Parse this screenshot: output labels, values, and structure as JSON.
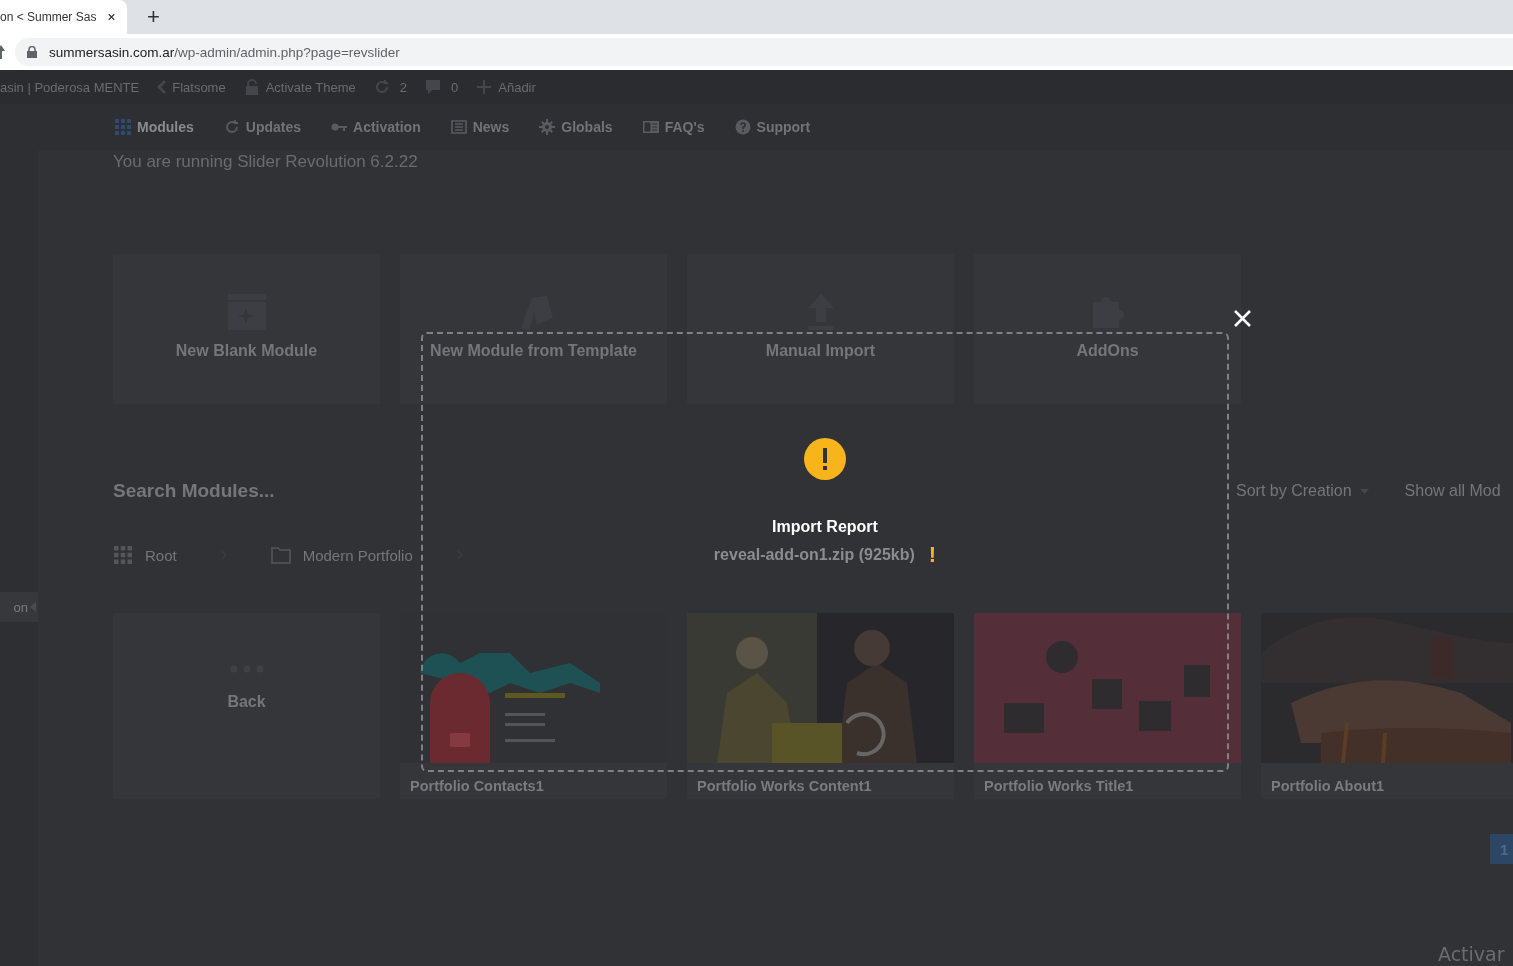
{
  "browser": {
    "tab": {
      "title": "on < Summer Sas",
      "selected": true
    },
    "new_tab": "+",
    "url_host": "summersasin.com.ar",
    "url_path": "/wp-admin/admin.php?page=revslider"
  },
  "admin_bar": [
    {
      "kind": "text",
      "label": "asin | Poderosa MENTE"
    },
    {
      "kind": "theme",
      "label": "Flatsome"
    },
    {
      "kind": "lock",
      "label": "Activate Theme"
    },
    {
      "kind": "updates",
      "label": "2"
    },
    {
      "kind": "comments",
      "label": "0"
    },
    {
      "kind": "add",
      "label": "Añadir"
    }
  ],
  "nav": [
    {
      "label": "Modules",
      "selected": true
    },
    {
      "label": "Updates",
      "selected": false
    },
    {
      "label": "Activation",
      "selected": false
    },
    {
      "label": "News",
      "selected": false
    },
    {
      "label": "Globals",
      "selected": false
    },
    {
      "label": "FAQ's",
      "selected": false
    },
    {
      "label": "Support",
      "selected": false
    }
  ],
  "version_notice": "You are running Slider Revolution 6.2.22",
  "actions": [
    {
      "label": "New Blank Module"
    },
    {
      "label": "New Module from Template"
    },
    {
      "label": "Manual Import"
    },
    {
      "label": "AddOns"
    }
  ],
  "search": {
    "placeholder": "Search Modules..."
  },
  "sort": "Sort by Creation",
  "filter": "Show all Mod",
  "breadcrumb": [
    {
      "label": "Root"
    },
    {
      "label": "Modern Portfolio"
    }
  ],
  "side_tab": "on",
  "modules": [
    {
      "kind": "back",
      "label": "Back"
    },
    {
      "kind": "picture",
      "title": "Portfolio Contacts1"
    },
    {
      "kind": "picture",
      "title": "Portfolio Works Content1"
    },
    {
      "kind": "picture",
      "title": "Portfolio Works Title1"
    },
    {
      "kind": "picture",
      "title": "Portfolio About1"
    }
  ],
  "pagination": [
    {
      "label": "1",
      "selected": true
    }
  ],
  "modal": {
    "title": "Import Report",
    "file": "reveal-add-on1.zip (925kb)",
    "flag": "!"
  },
  "os_notice": "Activar"
}
